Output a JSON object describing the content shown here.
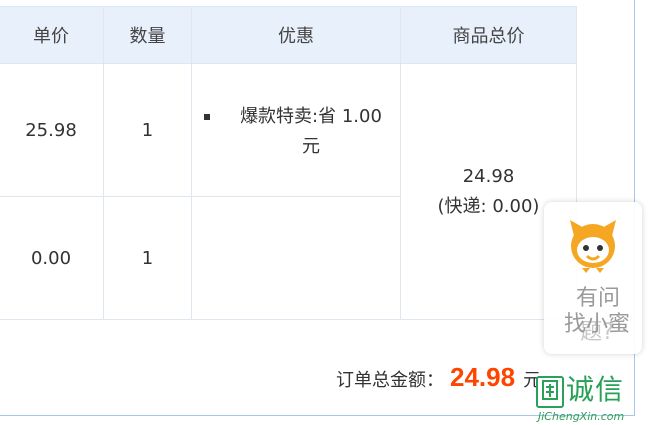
{
  "table": {
    "headers": {
      "price": "单价",
      "quantity": "数量",
      "promotion": "优惠",
      "subtotal": "商品总价"
    },
    "rows": [
      {
        "price": "25.98",
        "quantity": "1",
        "promotion": "爆款特卖:省 1.00 元"
      },
      {
        "price": "0.00",
        "quantity": "1",
        "promotion": ""
      }
    ],
    "subtotal": {
      "amount": "24.98",
      "shipping": "(快递: 0.00)"
    }
  },
  "summary": {
    "label": "订单总金额：",
    "amount": "24.98",
    "unit": "元"
  },
  "helper": {
    "label_line1": "有问",
    "label_line2": "找小蜜",
    "label_line3": "题?"
  },
  "watermark": {
    "logo_char": "🔲",
    "text": "诚信",
    "url": "JiChengXin.com"
  },
  "colors": {
    "accent": "#ff4400",
    "header_bg": "#e8f1fb",
    "helper_orange": "#f5a623",
    "watermark_green": "#27a058"
  }
}
